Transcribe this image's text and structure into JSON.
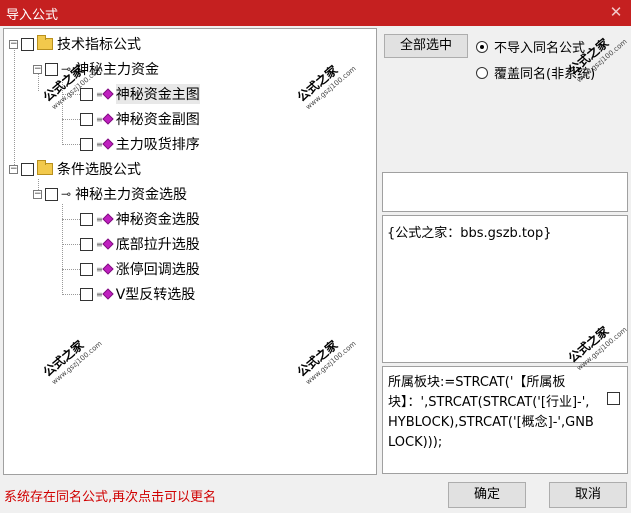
{
  "window": {
    "title": "导入公式",
    "close_glyph": "✕"
  },
  "tree": {
    "items": [
      {
        "label": "技术指标公式",
        "type": "folder"
      },
      {
        "label": "神秘主力资金",
        "type": "key"
      },
      {
        "label": "神秘资金主图",
        "type": "formula"
      },
      {
        "label": "神秘资金副图",
        "type": "formula"
      },
      {
        "label": "主力吸货排序",
        "type": "formula"
      },
      {
        "label": "条件选股公式",
        "type": "folder"
      },
      {
        "label": "神秘主力资金选股",
        "type": "key"
      },
      {
        "label": "神秘资金选股",
        "type": "formula"
      },
      {
        "label": "底部拉升选股",
        "type": "formula"
      },
      {
        "label": "涨停回调选股",
        "type": "formula"
      },
      {
        "label": "V型反转选股",
        "type": "formula"
      }
    ]
  },
  "actions": {
    "select_all": "全部选中",
    "opt_skip": "不导入同名公式",
    "opt_overwrite": "覆盖同名(非系统)"
  },
  "description": "{公式之家：bbs.gszb.top}",
  "formula": "所属板块:=STRCAT('【所属板块】：',STRCAT(STRCAT('[行业]-',HYBLOCK),STRCAT('[概念]-',GNBLOCK)));",
  "status": "系统存在同名公式,再次点击可以更名",
  "buttons": {
    "ok": "确定",
    "cancel": "取消"
  },
  "watermark": {
    "cn": "公式之家",
    "url": "www.gszj100.com"
  },
  "colors": {
    "titlebar": "#c52020",
    "status_text": "#d00000",
    "formula_icon": "#c020c0"
  }
}
